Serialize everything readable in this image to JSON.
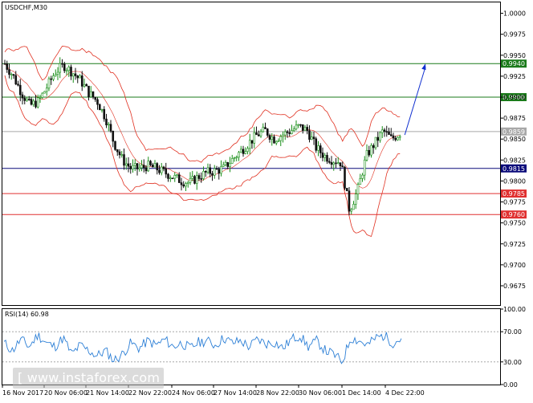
{
  "symbol_label": "USDCHF,M30",
  "rsi_label": "RSI(14) 60.98",
  "watermark": "[ www.instaforex.com ]",
  "colors": {
    "bull": "#1a8f1a",
    "bear": "#111111",
    "band": "#e03020",
    "resistance": "#1a7a1a",
    "pivot": "#0a0a7a",
    "support": "#e03030",
    "current": "#a8a8a8",
    "rsi": "#2c7fd6",
    "arrow": "#1030d0"
  },
  "chart_data": {
    "type": "candlestick",
    "ylim": [
      0.9652,
      1.0013
    ],
    "y_ticks": [
      "1.0000",
      "0.9975",
      "0.9950",
      "0.9925",
      "0.9900",
      "0.9875",
      "0.9850",
      "0.9825",
      "0.9800",
      "0.9775",
      "0.9750",
      "0.9725",
      "0.9700",
      "0.9675"
    ],
    "x_labels": [
      "16 Nov 2017",
      "20 Nov 06:00",
      "21 Nov 14:00",
      "22 Nov 22:00",
      "24 Nov 06:00",
      "27 Nov 14:00",
      "28 Nov 22:00",
      "30 Nov 06:00",
      "1 Dec 14:00",
      "4 Dec 22:00"
    ],
    "levels": [
      {
        "label": "0.9940",
        "value": 0.994,
        "role": "resistance"
      },
      {
        "label": "0.9900",
        "value": 0.99,
        "role": "resistance"
      },
      {
        "label": "0.9859",
        "value": 0.9859,
        "role": "current"
      },
      {
        "label": "0.9815",
        "value": 0.9815,
        "role": "pivot"
      },
      {
        "label": "0.9785",
        "value": 0.9785,
        "role": "support"
      },
      {
        "label": "0.9760",
        "value": 0.976,
        "role": "support"
      }
    ],
    "price_path": [
      0.994,
      0.9925,
      0.9905,
      0.989,
      0.9895,
      0.9912,
      0.993,
      0.9938,
      0.993,
      0.992,
      0.9905,
      0.9895,
      0.9875,
      0.9845,
      0.9825,
      0.9815,
      0.9815,
      0.9818,
      0.9815,
      0.981,
      0.9805,
      0.98,
      0.9798,
      0.9805,
      0.981,
      0.9812,
      0.9815,
      0.9825,
      0.9835,
      0.9845,
      0.9855,
      0.986,
      0.985,
      0.9855,
      0.986,
      0.9865,
      0.986,
      0.984,
      0.983,
      0.9825,
      0.9822,
      0.9765,
      0.979,
      0.983,
      0.9845,
      0.986,
      0.985,
      0.9857
    ],
    "forecast_target": 0.994,
    "rsi": {
      "ylim": [
        0,
        100
      ],
      "y_ticks": [
        "100.00",
        "70.00",
        "30.00",
        "0.00"
      ],
      "guides": [
        70,
        30
      ],
      "path": [
        55,
        45,
        60,
        50,
        66,
        55,
        50,
        62,
        40,
        52,
        45,
        38,
        45,
        32,
        40,
        55,
        48,
        58,
        52,
        60,
        50,
        55,
        48,
        56,
        58,
        52,
        62,
        55,
        58,
        50,
        60,
        54,
        56,
        48,
        60,
        65,
        50,
        58,
        45,
        40,
        30,
        62,
        58,
        52,
        62,
        65,
        55,
        60.98
      ]
    }
  }
}
